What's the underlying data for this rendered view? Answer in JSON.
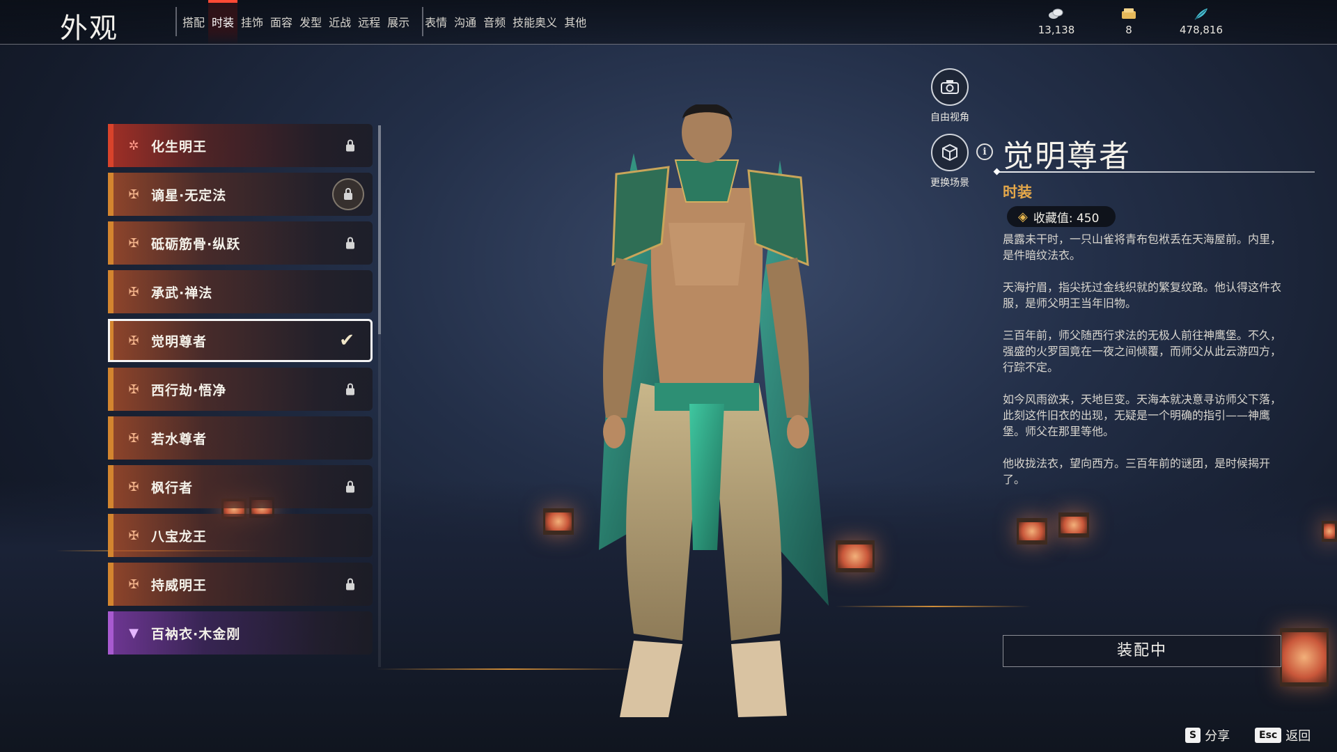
{
  "header": {
    "title": "外观",
    "tabs_group1": [
      {
        "label": "搭配",
        "active": false
      },
      {
        "label": "时装",
        "active": true
      },
      {
        "label": "挂饰",
        "active": false
      },
      {
        "label": "面容",
        "active": false
      },
      {
        "label": "发型",
        "active": false
      },
      {
        "label": "近战",
        "active": false
      },
      {
        "label": "远程",
        "active": false
      },
      {
        "label": "展示",
        "active": false
      }
    ],
    "tabs_group2": [
      {
        "label": "表情",
        "active": false
      },
      {
        "label": "沟通",
        "active": false
      },
      {
        "label": "音频",
        "active": false
      },
      {
        "label": "技能奥义",
        "active": false
      },
      {
        "label": "其他",
        "active": false
      }
    ],
    "currencies": [
      {
        "icon": "coin-stack-icon",
        "value": "13,138"
      },
      {
        "icon": "ticket-icon",
        "value": "8"
      },
      {
        "icon": "feather-icon",
        "value": "478,816"
      }
    ]
  },
  "outfits": [
    {
      "name": "化生明王",
      "rarity": "red",
      "icon": "star-icon",
      "status": "locked"
    },
    {
      "name": "谪星·无定法",
      "rarity": "orange",
      "icon": "rarity-icon",
      "status": "locked-circle"
    },
    {
      "name": "砥砺筋骨·纵跃",
      "rarity": "orange",
      "icon": "rarity-icon",
      "status": "locked"
    },
    {
      "name": "承武·禅法",
      "rarity": "orange",
      "icon": "rarity-icon",
      "status": "none"
    },
    {
      "name": "觉明尊者",
      "rarity": "orange",
      "icon": "rarity-icon",
      "status": "equipped"
    },
    {
      "name": "西行劫·悟净",
      "rarity": "orange",
      "icon": "rarity-icon",
      "status": "locked"
    },
    {
      "name": "若水尊者",
      "rarity": "orange",
      "icon": "rarity-icon",
      "status": "none"
    },
    {
      "name": "枫行者",
      "rarity": "orange",
      "icon": "rarity-icon",
      "status": "locked"
    },
    {
      "name": "八宝龙王",
      "rarity": "orange",
      "icon": "rarity-icon",
      "status": "none"
    },
    {
      "name": "持威明王",
      "rarity": "orange",
      "icon": "rarity-icon",
      "status": "locked"
    },
    {
      "name": "百衲衣·木金刚",
      "rarity": "purple",
      "icon": "rarity-icon",
      "status": "none"
    }
  ],
  "tools": {
    "free_camera": "自由视角",
    "change_scene": "更换场景"
  },
  "detail": {
    "title": "觉明尊者",
    "type": "时装",
    "collect_label": "收藏值: 450",
    "paragraphs": [
      "晨露未干时，一只山雀将青布包袱丢在天海屋前。内里，是件暗纹法衣。",
      "天海拧眉，指尖抚过金线织就的繁复纹路。他认得这件衣服，是师父明王当年旧物。",
      "三百年前，师父随西行求法的无极人前往神鹰堡。不久，强盛的火罗国竟在一夜之间倾覆，而师父从此云游四方，行踪不定。",
      "如今风雨欲来，天地巨变。天海本就决意寻访师父下落，此刻这件旧衣的出现，无疑是一个明确的指引——神鹰堡。师父在那里等他。",
      "他收拢法衣，望向西方。三百年前的谜团，是时候揭开了。"
    ],
    "equip_button": "装配中"
  },
  "footer": {
    "share_key": "S",
    "share_label": "分享",
    "back_key": "Esc",
    "back_label": "返回"
  },
  "colors": {
    "accent_red": "#ff4a35",
    "rarity_orange": "#d3852f",
    "rarity_red": "#d9432b",
    "rarity_purple": "#a85ad0",
    "type_gold": "#e5a84a"
  }
}
